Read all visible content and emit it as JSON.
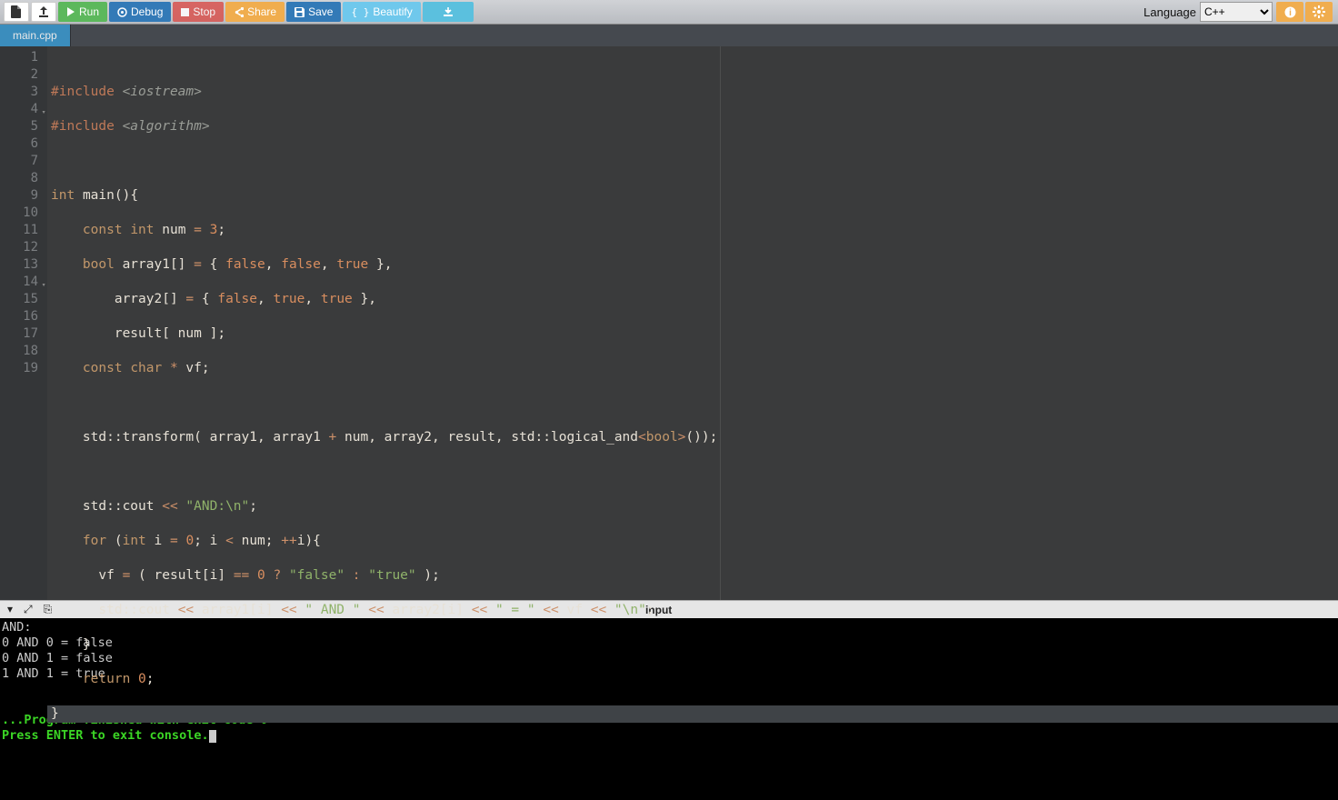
{
  "toolbar": {
    "run": "Run",
    "debug": "Debug",
    "stop": "Stop",
    "share": "Share",
    "save": "Save",
    "beautify": "Beautify",
    "language_label": "Language",
    "language_selected": "C++"
  },
  "tabs": {
    "main": "main.cpp"
  },
  "code": {
    "line_count": 19,
    "raw": "#include <iostream>\n#include <algorithm>\n\nint main(){\n    const int num = 3;\n    bool array1[] = { false, false, true },\n        array2[] = { false, true, true },\n        result[ num ];\n    const char * vf;\n\n    std::transform( array1, array1 + num, array2, result, std::logical_and<bool>());\n\n    std::cout << \"AND:\\n\";\n    for (int i = 0; i < num; ++i){\n      vf = ( result[i] == 0 ? \"false\" : \"true\" );\n      std::cout << array1[i] << \" AND \" << array2[i] << \" = \" << vf << \"\\n\";\n    }\n    return 0;\n}"
  },
  "console": {
    "input_label": "input",
    "output_plain": "AND:\n0 AND 0 = false\n0 AND 1 = false\n1 AND 1 = true",
    "status1": "...Program finished with exit code 0",
    "status2": "Press ENTER to exit console."
  }
}
